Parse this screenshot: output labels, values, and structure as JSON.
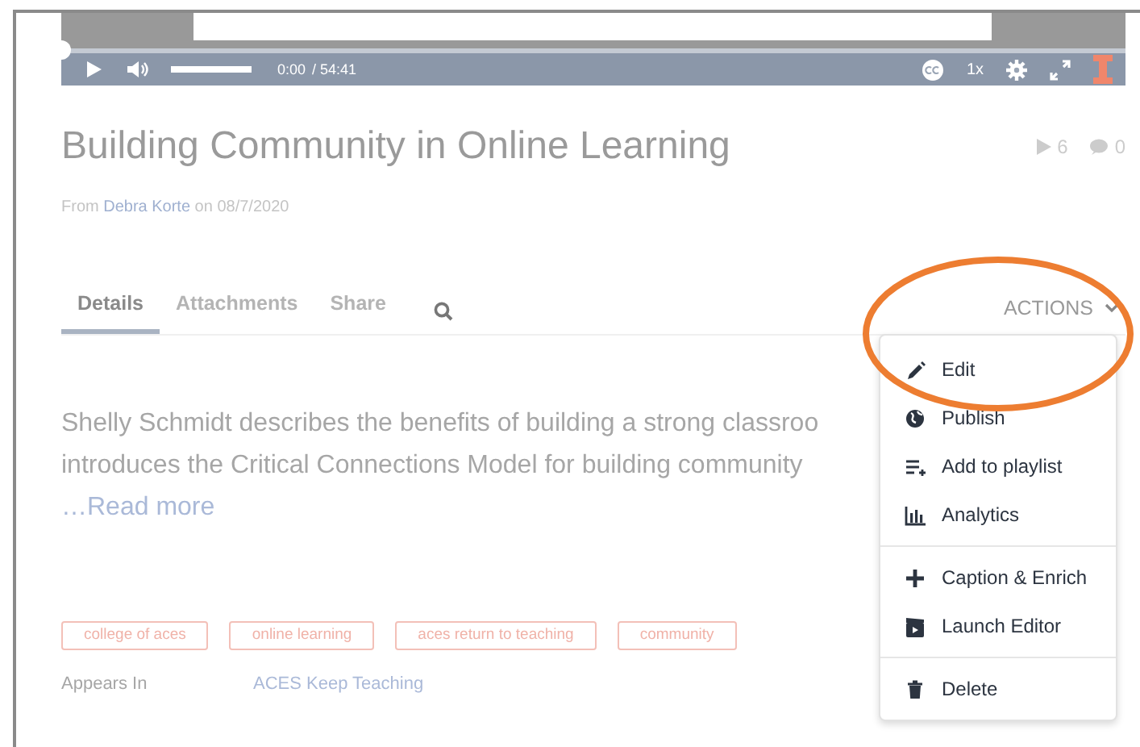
{
  "player": {
    "progress": {
      "level": 0
    },
    "volume": {
      "level": 1
    },
    "time": "0:00",
    "duration": "/ 54:41",
    "speed": "1x"
  },
  "title": "Building Community in Online Learning",
  "stats": [
    {
      "kind": "plays",
      "value": "6"
    },
    {
      "kind": "comments",
      "value": "0"
    }
  ],
  "byline": {
    "prefix": "From",
    "author": "Debra Korte",
    "suffix": "on 08/7/2020"
  },
  "tabs": [
    {
      "label": "Details",
      "selected": true
    },
    {
      "label": "Attachments",
      "selected": false
    },
    {
      "label": "Share",
      "selected": false
    }
  ],
  "actions": {
    "label": "ACTIONS",
    "expanded": true
  },
  "description": {
    "lines": [
      "Shelly Schmidt describes the benefits of building a strong classroo",
      "introduces the Critical Connections Model for building community"
    ],
    "more": "…Read more"
  },
  "tags": [
    "college of aces",
    "online learning",
    "aces return to teaching",
    "community"
  ],
  "appears_in": {
    "label": "Appears In",
    "value": "ACES Keep Teaching"
  },
  "menu": [
    [
      {
        "kind": "edit",
        "label": "Edit"
      },
      {
        "kind": "publish",
        "label": "Publish"
      },
      {
        "kind": "playlist",
        "label": "Add to playlist"
      },
      {
        "kind": "analytics",
        "label": "Analytics"
      }
    ],
    [
      {
        "kind": "caption",
        "label": "Caption & Enrich"
      },
      {
        "kind": "editor",
        "label": "Launch Editor"
      }
    ],
    [
      {
        "kind": "delete",
        "label": "Delete"
      }
    ]
  ],
  "highlight": {
    "kind": "ellipse",
    "color": "#ed7d31"
  }
}
